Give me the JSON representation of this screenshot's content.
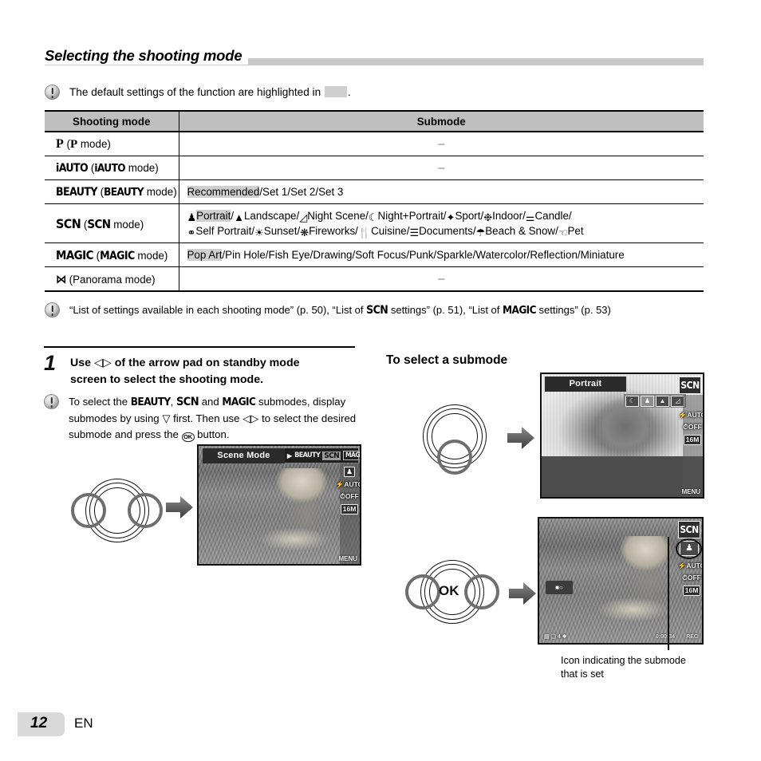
{
  "section": {
    "heading": "Selecting the shooting mode"
  },
  "notes": {
    "default_highlight": {
      "before": "The default settings of the function are highlighted in",
      "after": "."
    },
    "references": {
      "part1": "“List of settings available in each shooting mode” (p. 50), “List of",
      "scn": "SCN",
      "part2": "settings” (p. 51), “List of",
      "magic": "MAGIC",
      "part3": "settings” (p. 53)"
    }
  },
  "table": {
    "headers": [
      "Shooting mode",
      "Submode"
    ],
    "rows": [
      {
        "mode_mark": "P",
        "mode_paren_open": "(",
        "mode_paren_mark": "P",
        "mode_paren_text": "mode)",
        "submode": "–",
        "submode_centered": true,
        "highlight": ""
      },
      {
        "mode_mark": "iAUTO",
        "mode_paren_open": "(",
        "mode_paren_mark": "iAUTO",
        "mode_paren_text": "mode)",
        "submode": "–",
        "submode_centered": true,
        "highlight": ""
      },
      {
        "mode_mark": "BEAUTY",
        "mode_paren_open": "(",
        "mode_paren_mark": "BEAUTY",
        "mode_paren_text": "mode)",
        "submode": "Recommended/Set 1/Set 2/Set 3",
        "submode_centered": false,
        "highlight": "Recommended"
      },
      {
        "mode_mark": "SCN",
        "mode_paren_open": "(",
        "mode_paren_mark": "SCN",
        "mode_paren_text": "mode)",
        "submode": "Portrait/Landscape/Night Scene/Night+Portrait/Sport/Indoor/Candle/Self Portrait/Sunset/Fireworks/Cuisine/Documents/Beach & Snow/Pet",
        "submode_centered": false,
        "highlight": "Portrait"
      },
      {
        "mode_mark": "MAGIC",
        "mode_paren_open": "(",
        "mode_paren_mark": "MAGIC",
        "mode_paren_text": "mode)",
        "submode": "Pop Art/Pin Hole/Fish Eye/Drawing/Soft Focus/Punk/Sparkle/Watercolor/Reflection/Miniature",
        "submode_centered": false,
        "highlight": "Pop Art"
      },
      {
        "mode_mark": "⋈",
        "mode_paren_open": "(",
        "mode_paren_mark": "",
        "mode_paren_text": "Panorama mode)",
        "submode": "–",
        "submode_centered": true,
        "highlight": ""
      }
    ],
    "scn_items": [
      {
        "icon": "portrait-icon",
        "label": "Portrait",
        "highlight": true
      },
      {
        "icon": "landscape-icon",
        "label": "Landscape",
        "highlight": false
      },
      {
        "icon": "night-scene-icon",
        "label": "Night Scene",
        "highlight": false
      },
      {
        "icon": "night-portrait-icon",
        "label": "Night+Portrait",
        "highlight": false
      },
      {
        "icon": "sport-icon",
        "label": "Sport",
        "highlight": false
      },
      {
        "icon": "indoor-icon",
        "label": "Indoor",
        "highlight": false
      },
      {
        "icon": "candle-icon",
        "label": "Candle",
        "highlight": false
      },
      {
        "icon": "self-portrait-icon",
        "label": "Self Portrait",
        "highlight": false
      },
      {
        "icon": "sunset-icon",
        "label": "Sunset",
        "highlight": false
      },
      {
        "icon": "fireworks-icon",
        "label": "Fireworks",
        "highlight": false
      },
      {
        "icon": "cuisine-icon",
        "label": "Cuisine",
        "highlight": false
      },
      {
        "icon": "documents-icon",
        "label": "Documents",
        "highlight": false
      },
      {
        "icon": "beach-snow-icon",
        "label": "Beach & Snow",
        "highlight": false
      },
      {
        "icon": "pet-icon",
        "label": "Pet",
        "highlight": false
      }
    ],
    "magic_items": [
      "Pop Art",
      "Pin Hole",
      "Fish Eye",
      "Drawing",
      "Soft Focus",
      "Punk",
      "Sparkle",
      "Watercolor",
      "Reflection",
      "Miniature"
    ],
    "beauty_items": [
      "Recommended",
      "Set 1",
      "Set 2",
      "Set 3"
    ]
  },
  "step1": {
    "number": "1",
    "line1_a": "Use",
    "line1_arrows": "◁▷",
    "line1_b": "of the arrow pad on standby mode",
    "line2": "screen to select the shooting mode.",
    "note": {
      "a": "To select the",
      "beauty": "BEAUTY",
      "comma": ",",
      "scn": "SCN",
      "b": "and",
      "magic": "MAGIC",
      "c": "submodes,",
      "d": "display submodes by using",
      "down": "▽",
      "e": "first. Then use",
      "lr": "◁▷",
      "f": "to",
      "g": "select the desired submode and press the",
      "ok": "OK",
      "h": "button."
    }
  },
  "right_column": {
    "heading": "To select a submode",
    "caption_line1": "Icon indicating the submode",
    "caption_line2": "that is set"
  },
  "lcd_scene_mode": {
    "title": "Scene Mode",
    "modebar": {
      "left_arrow": "▶",
      "beauty": "BEAUTY",
      "scn": "SCN",
      "magic": "MAGIC",
      "right_arrow": "▷"
    },
    "icons": [
      {
        "name": "portrait-submode-icon",
        "label": ""
      },
      {
        "name": "flash-auto-icon",
        "label": "AUTO"
      },
      {
        "name": "self-timer-off-icon",
        "label": "OFF"
      },
      {
        "name": "image-size-icon",
        "label": "16M"
      }
    ],
    "menu_label": "MENU"
  },
  "lcd_portrait": {
    "title": "Portrait",
    "mode_badge": "SCN",
    "submode_icons": [
      "night-portrait-icon",
      "portrait-icon",
      "landscape-icon",
      "night-scene-icon"
    ],
    "icons": [
      {
        "name": "flash-auto-icon",
        "label": "AUTO"
      },
      {
        "name": "self-timer-off-icon",
        "label": "OFF"
      },
      {
        "name": "image-size-icon",
        "label": "16M"
      }
    ],
    "menu_label": "MENU"
  },
  "lcd_result": {
    "mode_badge": "SCN",
    "submode_icon": "portrait-icon",
    "icons": [
      {
        "name": "flash-auto-icon",
        "label": "AUTO"
      },
      {
        "name": "self-timer-off-icon",
        "label": "OFF"
      },
      {
        "name": "image-size-icon",
        "label": "16M"
      }
    ],
    "osd_left": "▤ ❑ 4 ❖",
    "osd_right": "0:00:34",
    "osd_rec": "REC"
  },
  "arrow_pads": {
    "pad_left_right_label": "",
    "pad_down_label": "",
    "pad_ok_label": "OK"
  },
  "footer": {
    "page": "12",
    "language": "EN"
  },
  "colors": {
    "header_gray": "#bfbfbf",
    "highlight_gray": "#cfcfcf",
    "rule_gray": "#c8c8c8",
    "footer_gray": "#d9d9d9"
  }
}
